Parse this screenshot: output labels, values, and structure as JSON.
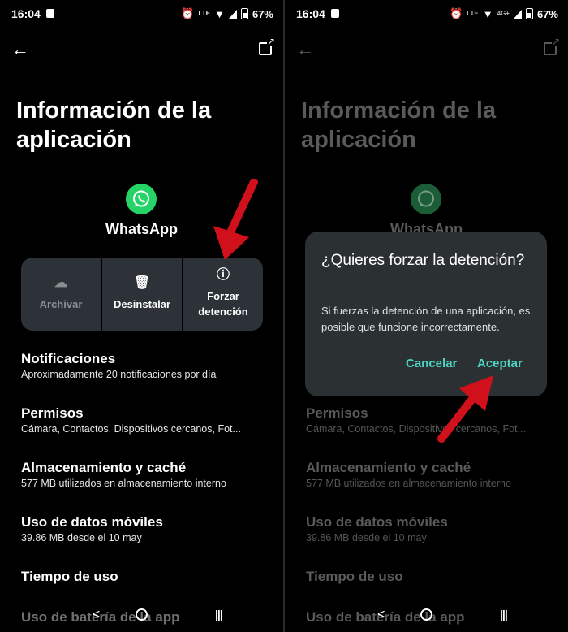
{
  "status": {
    "time": "16:04",
    "lte": "LTE",
    "net": "4G+",
    "battery": "67%"
  },
  "page_title": "Información de la aplicación",
  "app": {
    "name": "WhatsApp"
  },
  "actions": [
    {
      "label": "Archivar",
      "icon": "cloud-upload-icon",
      "enabled": false
    },
    {
      "label": "Desinstalar",
      "icon": "trash-icon",
      "enabled": true
    },
    {
      "label": "Forzar detención",
      "icon": "alert-circle-icon",
      "enabled": true
    }
  ],
  "items": [
    {
      "title": "Notificaciones",
      "subtitle": "Aproximadamente 20 notificaciones por día"
    },
    {
      "title": "Permisos",
      "subtitle": "Cámara, Contactos, Dispositivos cercanos, Fot..."
    },
    {
      "title": "Almacenamiento y caché",
      "subtitle": "577 MB utilizados en almacenamiento interno"
    },
    {
      "title": "Uso de datos móviles",
      "subtitle": "39.86 MB desde el 10 may"
    },
    {
      "title": "Tiempo de uso",
      "subtitle": ""
    },
    {
      "title": "Uso de batería de la app",
      "subtitle": ""
    }
  ],
  "dialog": {
    "title": "¿Quieres forzar la detención?",
    "message": "Si fuerzas la detención de una aplicación, es posible que funcione incorrectamente.",
    "cancel": "Cancelar",
    "accept": "Aceptar"
  },
  "colors": {
    "accent": "#4fd4c4",
    "annotation_arrow": "#d0101a",
    "whatsapp": "#25d366"
  }
}
